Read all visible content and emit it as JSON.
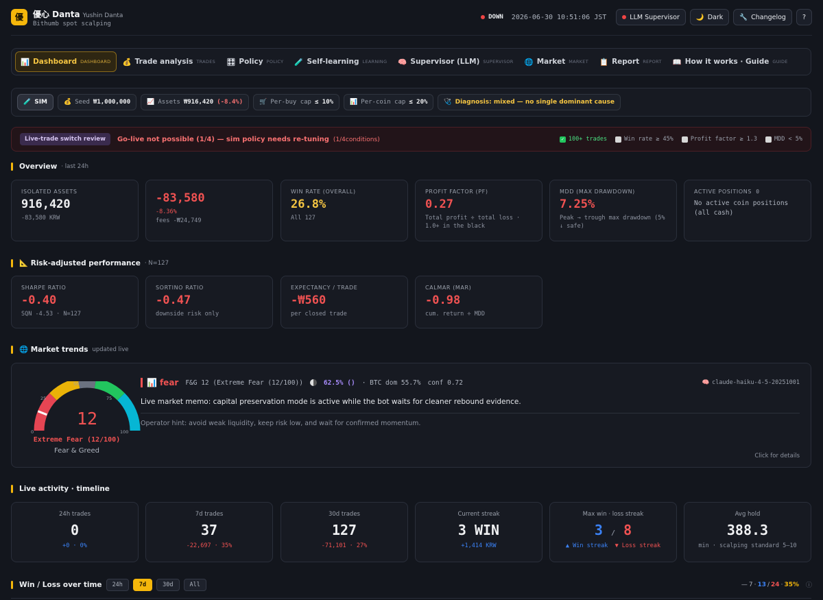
{
  "header": {
    "logo": "優",
    "title": "優心 Danta",
    "user": "Yushin Danta",
    "tagline": "Bithumb spot scalping",
    "status": "DOWN",
    "timestamp": "2026-06-30 10:51:06 JST",
    "llm_button": "LLM Supervisor",
    "theme_button": "Dark",
    "changelog_button": "Changelog",
    "help_button": "?"
  },
  "nav": {
    "tabs": [
      {
        "icon": "📊",
        "label": "Dashboard",
        "tag": "DASHBOARD",
        "active": true
      },
      {
        "icon": "💰",
        "label": "Trade analysis",
        "tag": "TRADES"
      },
      {
        "icon": "🎛",
        "label": "Policy",
        "tag": "POLICY"
      },
      {
        "icon": "🧪",
        "label": "Self-learning",
        "tag": "LEARNING"
      },
      {
        "icon": "🧠",
        "label": "Supervisor (LLM)",
        "tag": "SUPERVISOR"
      },
      {
        "icon": "🌐",
        "label": "Market",
        "tag": "MARKET"
      },
      {
        "icon": "📋",
        "label": "Report",
        "tag": "REPORT"
      },
      {
        "icon": "📖",
        "label": "How it works · Guide",
        "tag": "GUIDE"
      }
    ]
  },
  "simbar": {
    "sim": "SIM",
    "seed_label": "Seed",
    "seed_value": "₩1,000,000",
    "assets_label": "Assets",
    "assets_value": "₩916,420",
    "assets_change": "(-8.4%)",
    "perbuy_label": "Per-buy cap",
    "perbuy_value": "≤ 10%",
    "percoin_label": "Per-coin cap",
    "percoin_value": "≤ 20%",
    "diagnosis": "Diagnosis: mixed — no single dominant cause"
  },
  "live": {
    "badge": "Live-trade switch review",
    "message": "Go-live not possible (1/4) — sim policy needs re-tuning",
    "conditions_note": "(1/4conditions)",
    "conditions": [
      {
        "label": "100+ trades",
        "ok": true
      },
      {
        "label": "Win rate ≥ 45%",
        "ok": false
      },
      {
        "label": "Profit factor ≥ 1.3",
        "ok": false
      },
      {
        "label": "MDD < 5%",
        "ok": false
      }
    ]
  },
  "overview": {
    "title": "Overview",
    "note": "· last 24h",
    "cards": [
      {
        "label": "ISOLATED ASSETS",
        "value": "916,420",
        "sub": "-83,580 KRW"
      },
      {
        "label": "",
        "value": "-83,580",
        "sub": "-8.36%",
        "sub2": "fees -₩24,749"
      },
      {
        "label": "WIN RATE (OVERALL)",
        "value": "26.8%",
        "sub": "All 127"
      },
      {
        "label": "PROFIT FACTOR (PF)",
        "value": "0.27",
        "sub": "Total profit ÷ total loss · 1.0+ in the black"
      },
      {
        "label": "MDD (MAX DRAWDOWN)",
        "value": "7.25%",
        "sub": "Peak → trough max drawdown (5% ↓ safe)"
      },
      {
        "label": "ACTIVE POSITIONS",
        "count": "0",
        "sub": "No active coin positions (all cash)"
      }
    ]
  },
  "risk": {
    "title": "📐 Risk-adjusted performance",
    "note": "· N=127",
    "cards": [
      {
        "label": "SHARPE RATIO",
        "value": "-0.40",
        "sub": "SQN -4.53 · N=127"
      },
      {
        "label": "SORTINO RATIO",
        "value": "-0.47",
        "sub": "downside risk only"
      },
      {
        "label": "EXPECTANCY / TRADE",
        "value": "-₩560",
        "sub": "per closed trade"
      },
      {
        "label": "CALMAR (MAR)",
        "value": "-0.98",
        "sub": "cum. return ÷ MDD"
      }
    ]
  },
  "market": {
    "title": "🌐 Market trends",
    "note": "updated live",
    "gauge": {
      "value": 12,
      "ticks": [
        "0",
        "25",
        "50",
        "75",
        "100"
      ],
      "label": "Extreme Fear (12/100)",
      "sub": "Fear & Greed"
    },
    "mood_icon": "📊",
    "mood": "fear",
    "fg_text": "F&G 12 (Extreme Fear (12/100))",
    "btc_pct": "62.5% ()",
    "btc_dom": "· BTC dom 55.7%",
    "conf": "conf 0.72",
    "model": "claude-haiku-4-5-20251001",
    "memo": "Live market memo: capital preservation mode is active while the bot waits for cleaner rebound evidence.",
    "hint": "Operator hint: avoid weak liquidity, keep risk low, and wait for confirmed momentum.",
    "details": "Click for details"
  },
  "activity": {
    "title": "Live activity · timeline",
    "cards": [
      {
        "label": "24h trades",
        "value": "0",
        "sub": "+0 · 0%",
        "tone": "blue"
      },
      {
        "label": "7d trades",
        "value": "37",
        "sub": "-22,697 · 35%",
        "tone": "red"
      },
      {
        "label": "30d trades",
        "value": "127",
        "sub": "-71,101 · 27%",
        "tone": "red"
      },
      {
        "label": "Current streak",
        "value": "3 WIN",
        "sub": "+1,414 KRW",
        "tone": "blue"
      },
      {
        "label": "Max win · loss streak",
        "win": "3",
        "sep": "/",
        "loss": "8",
        "sub_win": "▲ Win streak",
        "sub_loss": "▼ Loss streak"
      },
      {
        "label": "Avg hold",
        "value": "388.3",
        "sub": "min · scalping standard 5–10",
        "tone": "gray"
      }
    ]
  },
  "winloss": {
    "title": "Win / Loss over time",
    "ranges": [
      {
        "label": "24h",
        "active": false
      },
      {
        "label": "7d",
        "active": true
      },
      {
        "label": "30d",
        "active": false
      },
      {
        "label": "All",
        "active": false
      }
    ],
    "stat_prefix": "—",
    "stat_win": "7",
    "stat_dot1": "·",
    "stat_blue": "13",
    "stat_sep": "/",
    "stat_loss": "24",
    "stat_dot2": "·",
    "stat_pct": "35%",
    "info": "ⓘ"
  },
  "colors": {
    "accent": "#f5b70b",
    "negative": "#f05252",
    "positive": "#3b82f6",
    "background": "#13161d"
  }
}
